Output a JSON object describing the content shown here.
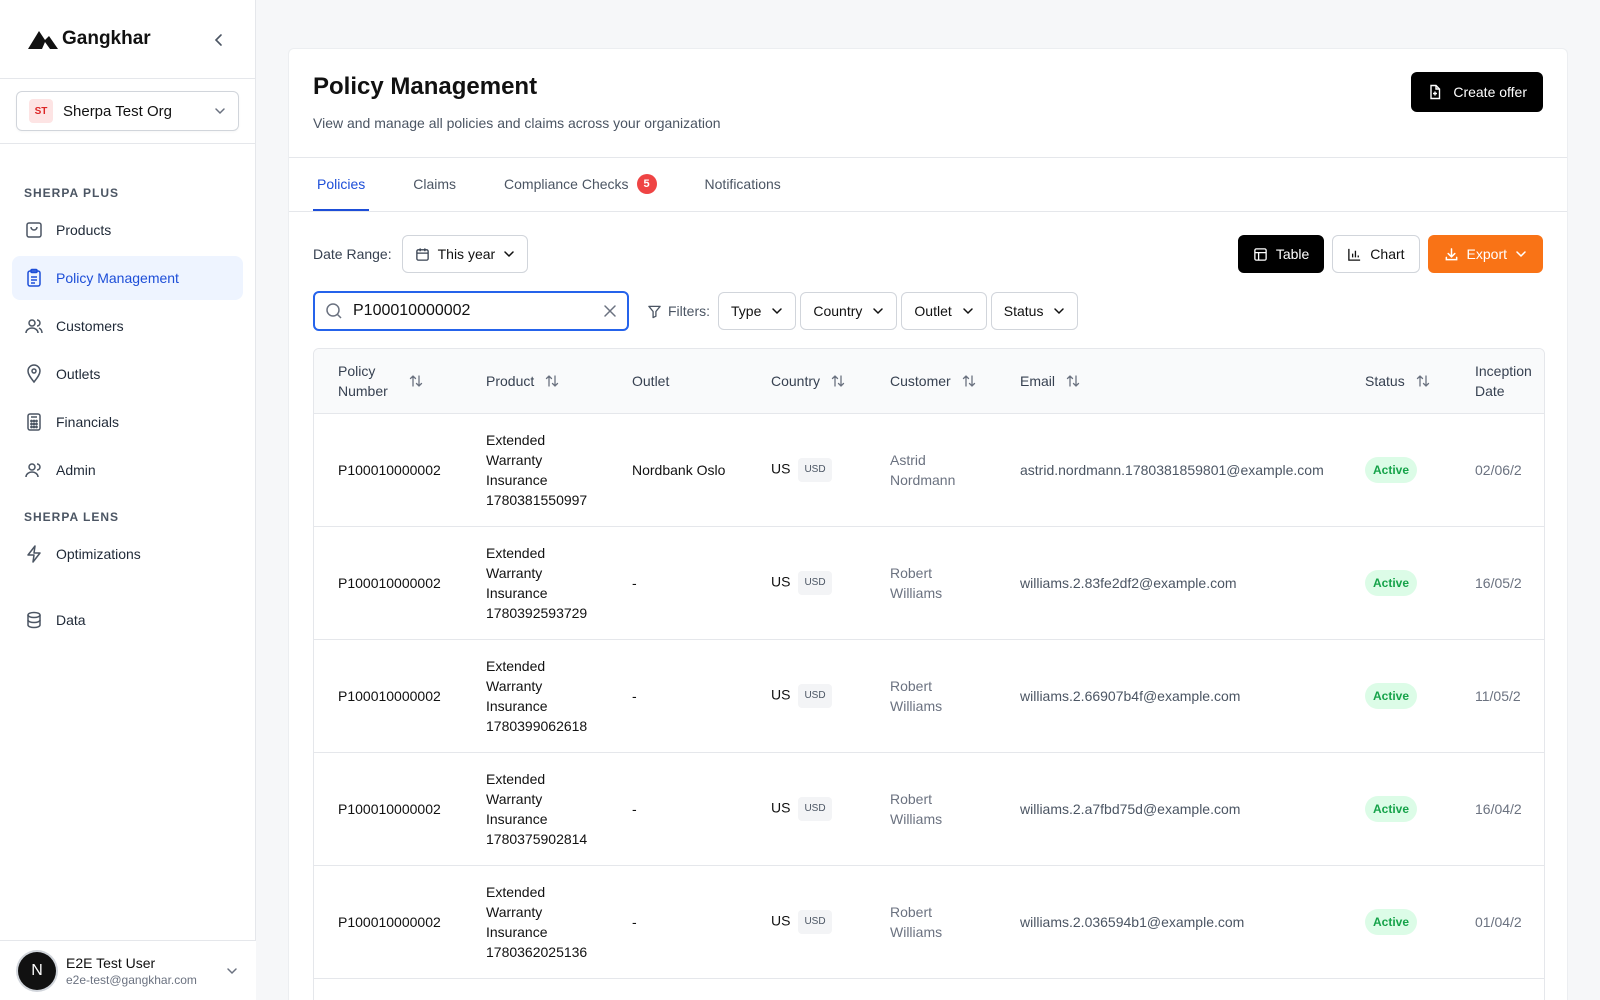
{
  "brand": {
    "name": "Gangkhar"
  },
  "org": {
    "initials": "ST",
    "name": "Sherpa Test Org"
  },
  "nav": {
    "section1": "SHERPA PLUS",
    "section2": "SHERPA LENS",
    "items": [
      {
        "label": "Products",
        "icon": "bag-icon"
      },
      {
        "label": "Policy Management",
        "icon": "clipboard-icon"
      },
      {
        "label": "Customers",
        "icon": "users-icon"
      },
      {
        "label": "Outlets",
        "icon": "map-pin-icon"
      },
      {
        "label": "Financials",
        "icon": "calculator-icon"
      },
      {
        "label": "Admin",
        "icon": "admin-users-icon"
      },
      {
        "label": "Optimizations",
        "icon": "lightning-icon"
      },
      {
        "label": "Data",
        "icon": "database-icon"
      }
    ]
  },
  "user": {
    "initial": "N",
    "name": "E2E Test User",
    "email": "e2e-test@gangkhar.com"
  },
  "header": {
    "title": "Policy Management",
    "subtitle": "View and manage all policies and claims across your organization",
    "create_label": "Create offer"
  },
  "tabs": [
    {
      "label": "Policies"
    },
    {
      "label": "Claims"
    },
    {
      "label": "Compliance Checks",
      "badge": "5"
    },
    {
      "label": "Notifications"
    }
  ],
  "toolbar": {
    "date_range_label": "Date Range:",
    "date_range_value": "This year",
    "table_label": "Table",
    "chart_label": "Chart",
    "export_label": "Export",
    "search_value": "P100010000002",
    "filters_label": "Filters:",
    "filters": [
      "Type",
      "Country",
      "Outlet",
      "Status"
    ]
  },
  "table": {
    "columns": {
      "policy_number": "Policy Number",
      "product": "Product",
      "outlet": "Outlet",
      "country": "Country",
      "customer": "Customer",
      "email": "Email",
      "status": "Status",
      "inception_date": "Inception Date"
    },
    "rows": [
      {
        "policy": "P100010000002",
        "product": "Extended Warranty Insurance 1780381550997",
        "outlet": "Nordbank Oslo",
        "country": "US",
        "currency": "USD",
        "customer": "Astrid Nordmann",
        "email": "astrid.nordmann.1780381859801@example.com",
        "status": "Active",
        "date": "02/06/2"
      },
      {
        "policy": "P100010000002",
        "product": "Extended Warranty Insurance 1780392593729",
        "outlet": "-",
        "country": "US",
        "currency": "USD",
        "customer": "Robert Williams",
        "email": "williams.2.83fe2df2@example.com",
        "status": "Active",
        "date": "16/05/2"
      },
      {
        "policy": "P100010000002",
        "product": "Extended Warranty Insurance 1780399062618",
        "outlet": "-",
        "country": "US",
        "currency": "USD",
        "customer": "Robert Williams",
        "email": "williams.2.66907b4f@example.com",
        "status": "Active",
        "date": "11/05/2"
      },
      {
        "policy": "P100010000002",
        "product": "Extended Warranty Insurance 1780375902814",
        "outlet": "-",
        "country": "US",
        "currency": "USD",
        "customer": "Robert Williams",
        "email": "williams.2.a7fbd75d@example.com",
        "status": "Active",
        "date": "16/04/2"
      },
      {
        "policy": "P100010000002",
        "product": "Extended Warranty Insurance 1780362025136",
        "outlet": "-",
        "country": "US",
        "currency": "USD",
        "customer": "Robert Williams",
        "email": "williams.2.036594b1@example.com",
        "status": "Active",
        "date": "01/04/2"
      }
    ]
  }
}
